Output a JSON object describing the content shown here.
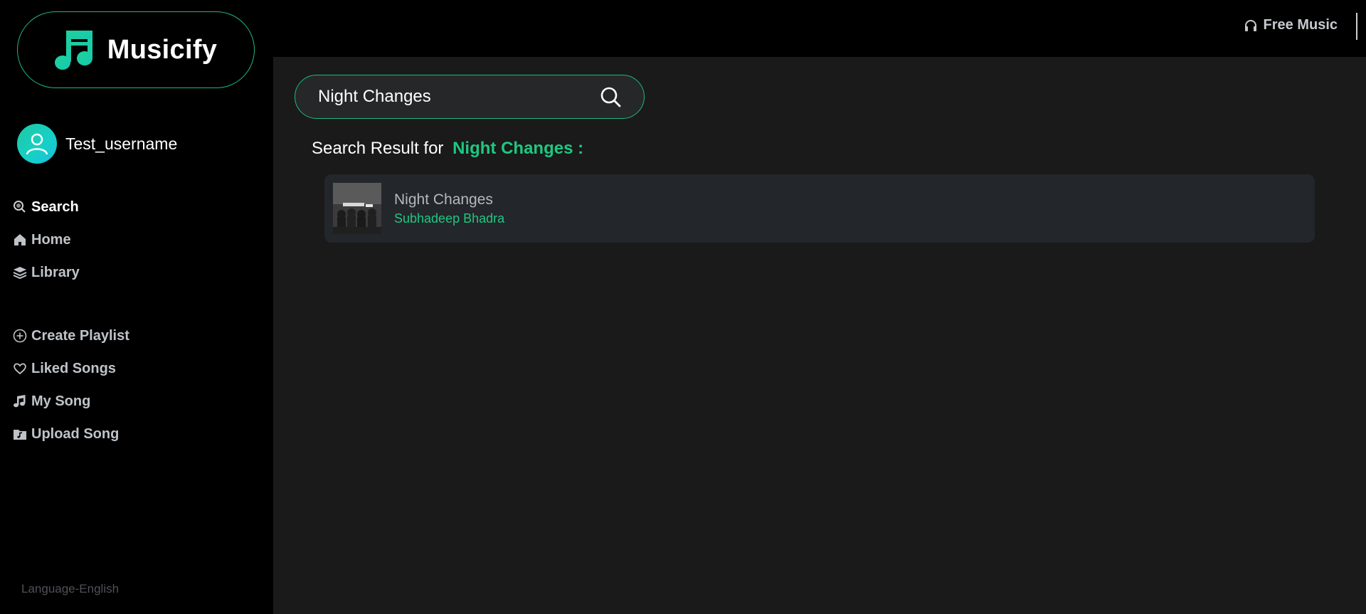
{
  "app": {
    "name": "Musicify"
  },
  "user": {
    "username": "Test_username"
  },
  "nav": {
    "primary": [
      {
        "label": "Search",
        "icon": "search-icon",
        "active": true
      },
      {
        "label": "Home",
        "icon": "home-icon"
      },
      {
        "label": "Library",
        "icon": "layers-icon"
      }
    ],
    "secondary": [
      {
        "label": "Create Playlist",
        "icon": "plus-circle-icon"
      },
      {
        "label": "Liked Songs",
        "icon": "heart-icon"
      },
      {
        "label": "My Song",
        "icon": "music-note-icon"
      },
      {
        "label": "Upload Song",
        "icon": "music-folder-icon"
      }
    ]
  },
  "footer": {
    "language": "Language-English"
  },
  "topbar": {
    "free_music": "Free Music",
    "icon": "headphones-icon"
  },
  "search": {
    "value": "Night Changes",
    "icon": "search-icon"
  },
  "results": {
    "heading_prefix": "Search Result for",
    "heading_term": "Night Changes :",
    "items": [
      {
        "title": "Night Changes",
        "artist": "Subhadeep Bhadra"
      }
    ]
  },
  "colors": {
    "accent": "#1fc781",
    "sidebar_bg": "#000000",
    "main_bg": "#1a1a1a",
    "card_bg": "#23262a"
  }
}
